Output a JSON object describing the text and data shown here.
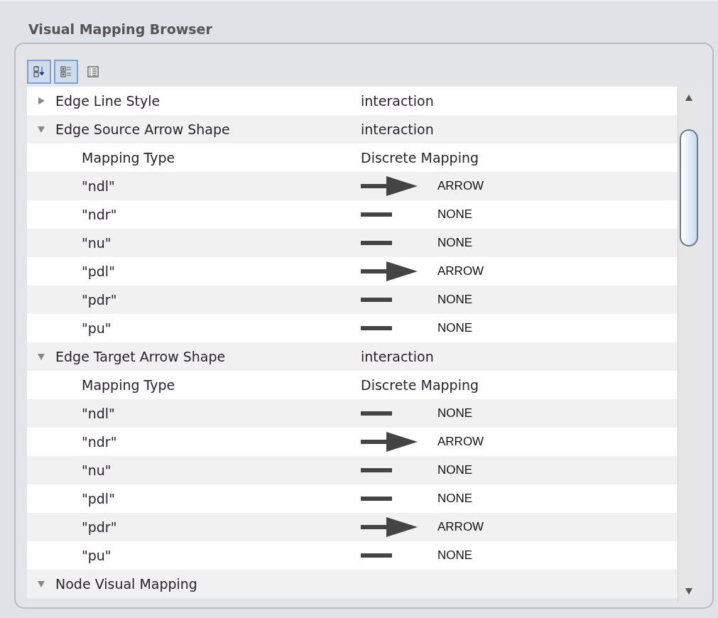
{
  "panel": {
    "title": "Visual Mapping Browser"
  },
  "toolbar": [
    {
      "kind": "sort",
      "selected": true
    },
    {
      "kind": "expand",
      "selected": true
    },
    {
      "kind": "list",
      "selected": false
    }
  ],
  "groups": [
    {
      "name": "Edge Line Style",
      "value": "interaction",
      "expanded": false
    },
    {
      "name": "Edge Source Arrow Shape",
      "value": "interaction",
      "expanded": true,
      "children": [
        {
          "kind": "type",
          "label": "Mapping Type",
          "value": "Discrete Mapping"
        },
        {
          "kind": "arrow",
          "label": "\"ndl\"",
          "value": "ARROW"
        },
        {
          "kind": "line",
          "label": "\"ndr\"",
          "value": "NONE"
        },
        {
          "kind": "line",
          "label": "\"nu\"",
          "value": "NONE"
        },
        {
          "kind": "arrow",
          "label": "\"pdl\"",
          "value": "ARROW"
        },
        {
          "kind": "line",
          "label": "\"pdr\"",
          "value": "NONE"
        },
        {
          "kind": "line",
          "label": "\"pu\"",
          "value": "NONE"
        }
      ]
    },
    {
      "name": "Edge Target Arrow Shape",
      "value": "interaction",
      "expanded": true,
      "children": [
        {
          "kind": "type",
          "label": "Mapping Type",
          "value": "Discrete Mapping"
        },
        {
          "kind": "line",
          "label": "\"ndl\"",
          "value": "NONE"
        },
        {
          "kind": "arrow",
          "label": "\"ndr\"",
          "value": "ARROW"
        },
        {
          "kind": "line",
          "label": "\"nu\"",
          "value": "NONE"
        },
        {
          "kind": "line",
          "label": "\"pdl\"",
          "value": "NONE"
        },
        {
          "kind": "arrow",
          "label": "\"pdr\"",
          "value": "ARROW"
        },
        {
          "kind": "line",
          "label": "\"pu\"",
          "value": "NONE"
        }
      ]
    },
    {
      "name": "Node Visual Mapping",
      "expanded": true
    }
  ]
}
